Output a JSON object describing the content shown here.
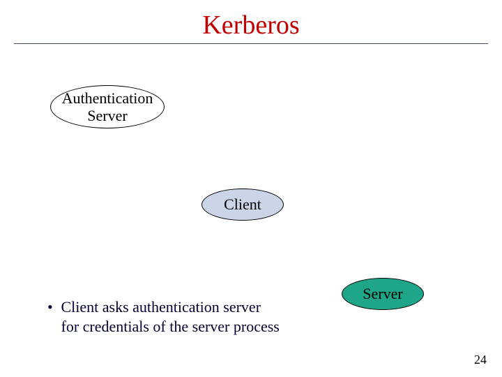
{
  "title": "Kerberos",
  "nodes": {
    "auth_server": "Authentication\nServer",
    "client": "Client",
    "server": "Server"
  },
  "bullet": {
    "line1": "Client asks authentication server",
    "line2": "for credentials of the server process"
  },
  "page_number": "24"
}
